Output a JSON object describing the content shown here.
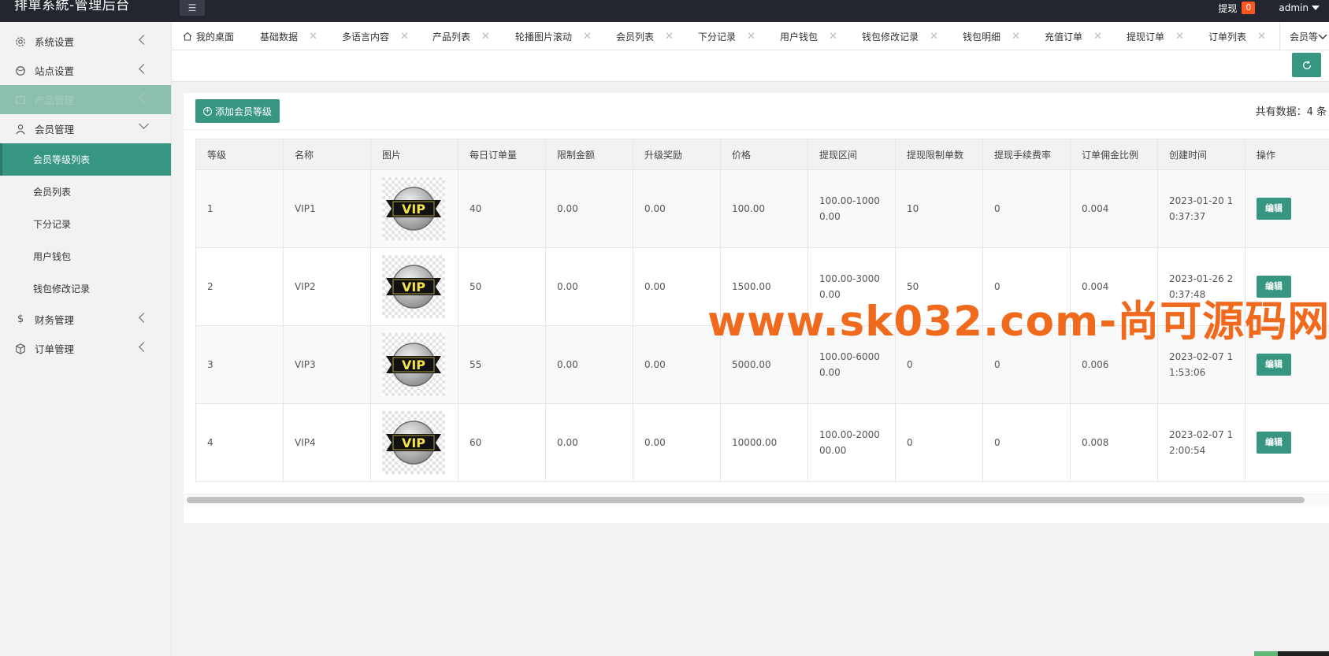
{
  "app": {
    "title": "排單系統-管理后台",
    "withdraw_label": "提现",
    "withdraw_count": "0",
    "user": "admin"
  },
  "sidebar": {
    "items": [
      {
        "label": "系统设置",
        "icon": "gear-icon"
      },
      {
        "label": "站点设置",
        "icon": "globe-icon"
      },
      {
        "label": "产品管理",
        "icon": "box-icon"
      },
      {
        "label": "会员管理",
        "icon": "user-icon"
      },
      {
        "label": "财务管理",
        "icon": "dollar-icon"
      },
      {
        "label": "订单管理",
        "icon": "cube-icon"
      }
    ],
    "member_sub": [
      {
        "label": "会员等级列表"
      },
      {
        "label": "会员列表"
      },
      {
        "label": "下分记录"
      },
      {
        "label": "用户钱包"
      },
      {
        "label": "钱包修改记录"
      }
    ]
  },
  "tabs": [
    {
      "label": "我的桌面"
    },
    {
      "label": "基础数据"
    },
    {
      "label": "多语言内容"
    },
    {
      "label": "产品列表"
    },
    {
      "label": "轮播图片滚动"
    },
    {
      "label": "会员列表"
    },
    {
      "label": "下分记录"
    },
    {
      "label": "用户钱包"
    },
    {
      "label": "钱包修改记录"
    },
    {
      "label": "钱包明细"
    },
    {
      "label": "充值订单"
    },
    {
      "label": "提现订单"
    },
    {
      "label": "订单列表"
    },
    {
      "label": "会员等"
    }
  ],
  "toolbar": {
    "add_label": "添加会员等级",
    "total_label": "共有数据：4 条"
  },
  "table": {
    "columns": [
      "等级",
      "名称",
      "图片",
      "每日订单量",
      "限制金额",
      "升级奖励",
      "价格",
      "提现区间",
      "提现限制单数",
      "提现手续费率",
      "订单佣金比例",
      "创建时间",
      "操作"
    ],
    "rows": [
      {
        "level": "1",
        "name": "VIP1",
        "daily": "40",
        "limit": "0.00",
        "reward": "0.00",
        "price": "100.00",
        "range": "100.00-10000.00",
        "wcount": "10",
        "fee": "0",
        "commission": "0.004",
        "created": "2023-01-20 10:37:37",
        "action": "编辑"
      },
      {
        "level": "2",
        "name": "VIP2",
        "daily": "50",
        "limit": "0.00",
        "reward": "0.00",
        "price": "1500.00",
        "range": "100.00-30000.00",
        "wcount": "50",
        "fee": "0",
        "commission": "0.004",
        "created": "2023-01-26 20:37:48",
        "action": "编辑"
      },
      {
        "level": "3",
        "name": "VIP3",
        "daily": "55",
        "limit": "0.00",
        "reward": "0.00",
        "price": "5000.00",
        "range": "100.00-60000.00",
        "wcount": "0",
        "fee": "0",
        "commission": "0.006",
        "created": "2023-02-07 11:53:06",
        "action": "编辑"
      },
      {
        "level": "4",
        "name": "VIP4",
        "daily": "60",
        "limit": "0.00",
        "reward": "0.00",
        "price": "10000.00",
        "range": "100.00-200000.00",
        "wcount": "0",
        "fee": "0",
        "commission": "0.008",
        "created": "2023-02-07 12:00:54",
        "action": "编辑"
      }
    ],
    "badge_text": "VIP"
  },
  "watermark": "www.sk032.com-尚可源码网",
  "colors": {
    "primary": "#379681",
    "header": "#23262e",
    "badge": "#ff5722",
    "watermark": "#f06a1e"
  }
}
